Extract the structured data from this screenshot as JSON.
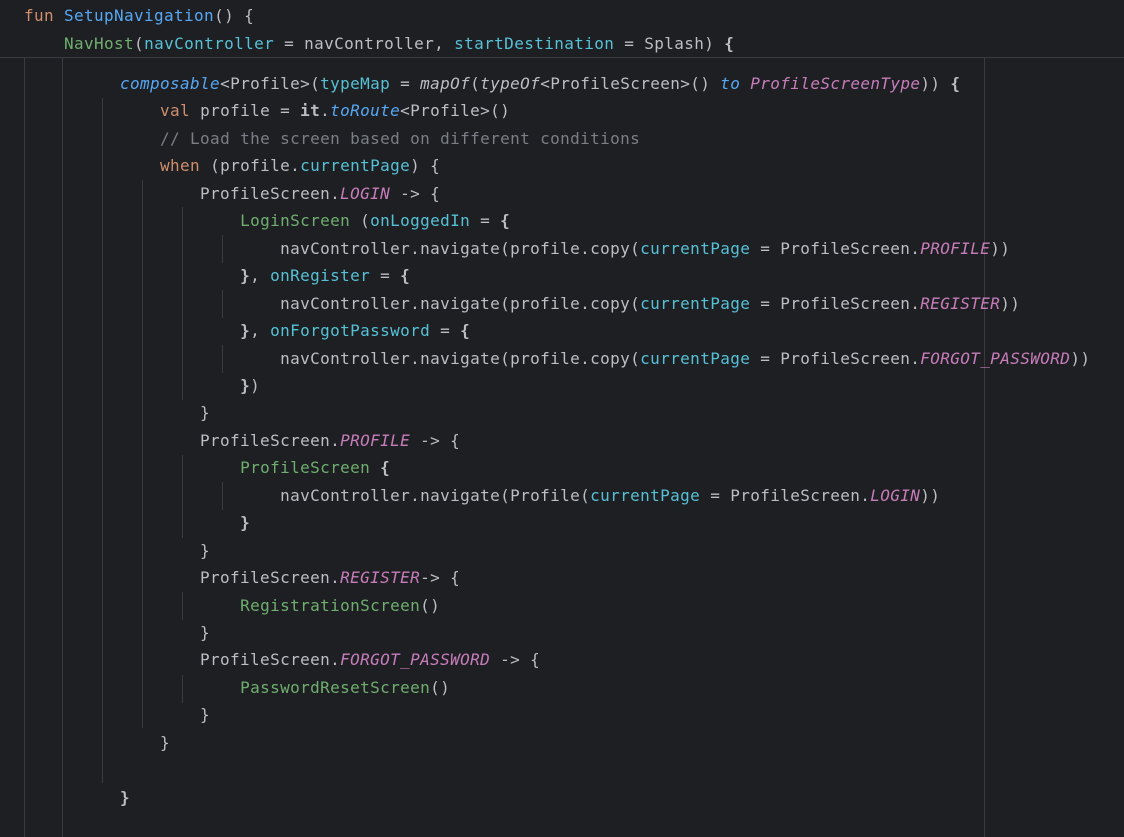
{
  "code": {
    "sticky": [
      [
        {
          "t": "kw",
          "v": "fun "
        },
        {
          "t": "fn",
          "v": "SetupNavigation"
        },
        {
          "t": "plain",
          "v": "() {"
        }
      ],
      [
        {
          "t": "plain",
          "v": "    "
        },
        {
          "t": "green",
          "v": "NavHost"
        },
        {
          "t": "plain",
          "v": "("
        },
        {
          "t": "param",
          "v": "navController"
        },
        {
          "t": "plain",
          "v": " = navController, "
        },
        {
          "t": "param",
          "v": "startDestination"
        },
        {
          "t": "plain",
          "v": " = Splash) "
        },
        {
          "t": "bold",
          "v": "{"
        }
      ]
    ],
    "lines": [
      [
        {
          "t": "plain",
          "v": "        "
        },
        {
          "t": "ital",
          "v": "composable"
        },
        {
          "t": "plain",
          "v": "<Profile>("
        },
        {
          "t": "param",
          "v": "typeMap"
        },
        {
          "t": "plain",
          "v": " = "
        },
        {
          "t": "ital2",
          "v": "mapOf"
        },
        {
          "t": "plain",
          "v": "("
        },
        {
          "t": "ital2",
          "v": "typeOf"
        },
        {
          "t": "plain",
          "v": "<ProfileScreen>() "
        },
        {
          "t": "ital",
          "v": "to"
        },
        {
          "t": "plain",
          "v": " "
        },
        {
          "t": "typ",
          "v": "ProfileScreenType"
        },
        {
          "t": "plain",
          "v": ")) "
        },
        {
          "t": "bold",
          "v": "{"
        }
      ],
      [
        {
          "t": "plain",
          "v": "            "
        },
        {
          "t": "kw",
          "v": "val"
        },
        {
          "t": "plain",
          "v": " profile = "
        },
        {
          "t": "bold",
          "v": "it"
        },
        {
          "t": "plain",
          "v": "."
        },
        {
          "t": "ital",
          "v": "toRoute"
        },
        {
          "t": "plain",
          "v": "<Profile>()"
        }
      ],
      [
        {
          "t": "plain",
          "v": "            "
        },
        {
          "t": "cmt",
          "v": "// Load the screen based on different conditions"
        }
      ],
      [
        {
          "t": "plain",
          "v": "            "
        },
        {
          "t": "kw",
          "v": "when"
        },
        {
          "t": "plain",
          "v": " (profile."
        },
        {
          "t": "prop",
          "v": "currentPage"
        },
        {
          "t": "plain",
          "v": ") {"
        }
      ],
      [
        {
          "t": "plain",
          "v": "                ProfileScreen."
        },
        {
          "t": "const",
          "v": "LOGIN"
        },
        {
          "t": "plain",
          "v": " -> {"
        }
      ],
      [
        {
          "t": "plain",
          "v": "                    "
        },
        {
          "t": "green",
          "v": "LoginScreen"
        },
        {
          "t": "plain",
          "v": " ("
        },
        {
          "t": "param",
          "v": "onLoggedIn"
        },
        {
          "t": "plain",
          "v": " = "
        },
        {
          "t": "bold",
          "v": "{"
        }
      ],
      [
        {
          "t": "plain",
          "v": "                        navController.navigate(profile.copy("
        },
        {
          "t": "param",
          "v": "currentPage"
        },
        {
          "t": "plain",
          "v": " = ProfileScreen."
        },
        {
          "t": "const",
          "v": "PROFILE"
        },
        {
          "t": "plain",
          "v": "))"
        }
      ],
      [
        {
          "t": "plain",
          "v": "                    "
        },
        {
          "t": "bold",
          "v": "}"
        },
        {
          "t": "plain",
          "v": ", "
        },
        {
          "t": "param",
          "v": "onRegister"
        },
        {
          "t": "plain",
          "v": " = "
        },
        {
          "t": "bold",
          "v": "{"
        }
      ],
      [
        {
          "t": "plain",
          "v": "                        navController.navigate(profile.copy("
        },
        {
          "t": "param",
          "v": "currentPage"
        },
        {
          "t": "plain",
          "v": " = ProfileScreen."
        },
        {
          "t": "const",
          "v": "REGISTER"
        },
        {
          "t": "plain",
          "v": "))"
        }
      ],
      [
        {
          "t": "plain",
          "v": "                    "
        },
        {
          "t": "bold",
          "v": "}"
        },
        {
          "t": "plain",
          "v": ", "
        },
        {
          "t": "param",
          "v": "onForgotPassword"
        },
        {
          "t": "plain",
          "v": " = "
        },
        {
          "t": "bold",
          "v": "{"
        }
      ],
      [
        {
          "t": "plain",
          "v": "                        navController.navigate(profile.copy("
        },
        {
          "t": "param",
          "v": "currentPage"
        },
        {
          "t": "plain",
          "v": " = ProfileScreen."
        },
        {
          "t": "const",
          "v": "FORGOT_PASSWORD"
        },
        {
          "t": "plain",
          "v": "))"
        }
      ],
      [
        {
          "t": "plain",
          "v": "                    "
        },
        {
          "t": "bold",
          "v": "}"
        },
        {
          "t": "plain",
          "v": ")"
        }
      ],
      [
        {
          "t": "plain",
          "v": "                }"
        }
      ],
      [
        {
          "t": "plain",
          "v": "                ProfileScreen."
        },
        {
          "t": "const",
          "v": "PROFILE"
        },
        {
          "t": "plain",
          "v": " -> {"
        }
      ],
      [
        {
          "t": "plain",
          "v": "                    "
        },
        {
          "t": "green",
          "v": "ProfileScreen"
        },
        {
          "t": "plain",
          "v": " "
        },
        {
          "t": "bold",
          "v": "{"
        }
      ],
      [
        {
          "t": "plain",
          "v": "                        navController.navigate(Profile("
        },
        {
          "t": "param",
          "v": "currentPage"
        },
        {
          "t": "plain",
          "v": " = ProfileScreen."
        },
        {
          "t": "const",
          "v": "LOGIN"
        },
        {
          "t": "plain",
          "v": "))"
        }
      ],
      [
        {
          "t": "plain",
          "v": "                    "
        },
        {
          "t": "bold",
          "v": "}"
        }
      ],
      [
        {
          "t": "plain",
          "v": "                }"
        }
      ],
      [
        {
          "t": "plain",
          "v": "                ProfileScreen."
        },
        {
          "t": "const",
          "v": "REGISTER"
        },
        {
          "t": "plain",
          "v": "-> {"
        }
      ],
      [
        {
          "t": "plain",
          "v": "                    "
        },
        {
          "t": "green",
          "v": "RegistrationScreen"
        },
        {
          "t": "plain",
          "v": "()"
        }
      ],
      [
        {
          "t": "plain",
          "v": "                }"
        }
      ],
      [
        {
          "t": "plain",
          "v": "                ProfileScreen."
        },
        {
          "t": "const",
          "v": "FORGOT_PASSWORD"
        },
        {
          "t": "plain",
          "v": " -> {"
        }
      ],
      [
        {
          "t": "plain",
          "v": "                    "
        },
        {
          "t": "green",
          "v": "PasswordResetScreen"
        },
        {
          "t": "plain",
          "v": "()"
        }
      ],
      [
        {
          "t": "plain",
          "v": "                }"
        }
      ],
      [
        {
          "t": "plain",
          "v": "            }"
        }
      ],
      [],
      [
        {
          "t": "plain",
          "v": "        "
        },
        {
          "t": "bold",
          "v": "}"
        }
      ]
    ]
  },
  "colors": {
    "background": "#1e1f22",
    "keyword": "#cf8e6d",
    "function": "#56a8f5",
    "parameter": "#56c1d6",
    "composable": "#6fae6f",
    "constant": "#c77dbb",
    "comment": "#7a7e85",
    "text": "#bcbec4"
  }
}
